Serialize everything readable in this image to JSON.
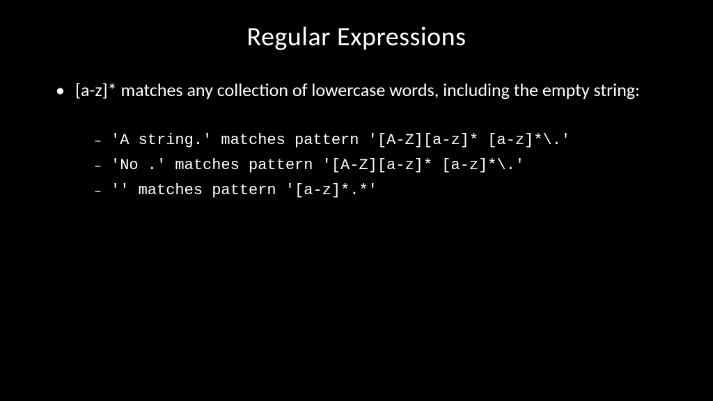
{
  "slide": {
    "title": "Regular Expressions",
    "main_bullet": "[a-z]* matches any collection of lowercase words, including the empty string:",
    "sub_bullets": [
      "'A string.' matches pattern '[A-Z][a-z]* [a-z]*\\.'",
      "'No .' matches pattern '[A-Z][a-z]* [a-z]*\\.'",
      "'' matches pattern '[a-z]*.*'"
    ]
  }
}
